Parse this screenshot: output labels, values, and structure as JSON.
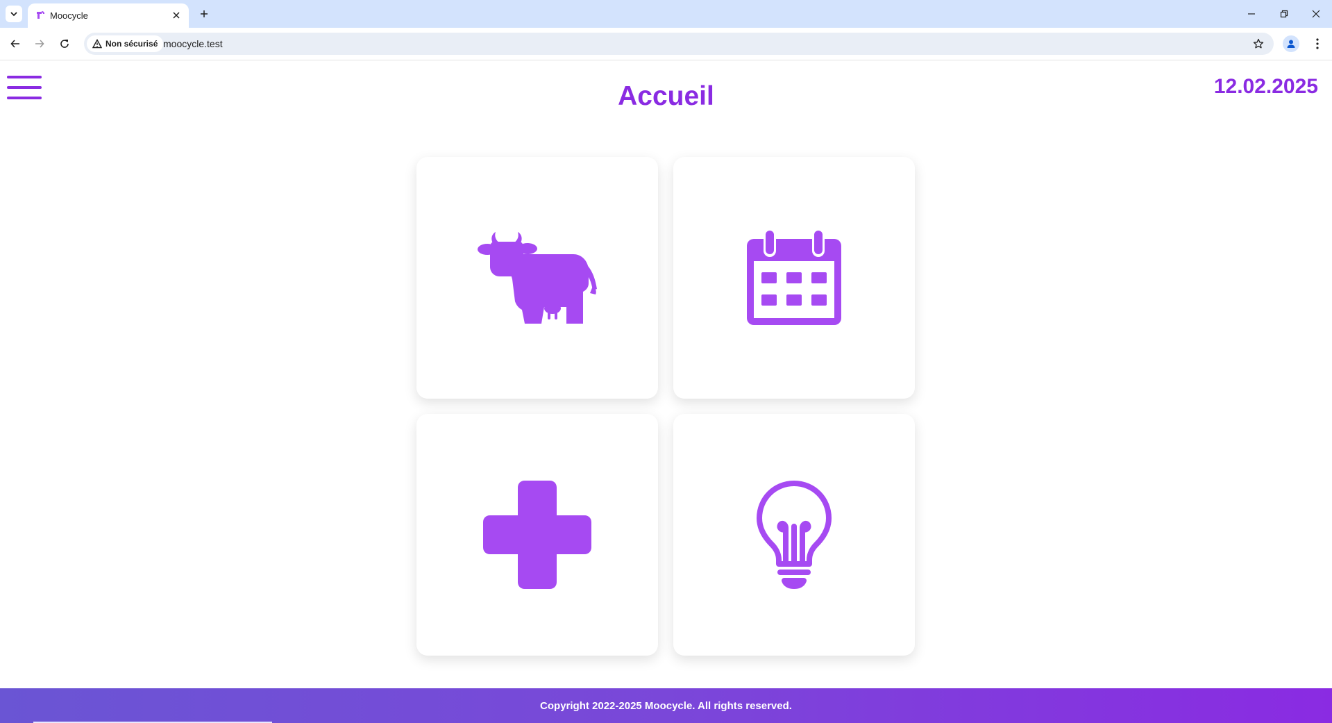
{
  "browser": {
    "tab_title": "Moocycle",
    "security_label": "Non sécurisé",
    "url": "moocycle.test"
  },
  "header": {
    "title": "Accueil",
    "date": "12.02.2025"
  },
  "cards": [
    {
      "icon": "cow-icon"
    },
    {
      "icon": "calendar-icon"
    },
    {
      "icon": "medical-cross-icon"
    },
    {
      "icon": "lightbulb-icon"
    }
  ],
  "colors": {
    "accent": "#8a2be2",
    "icon": "#a64af2",
    "tabbar": "#d3e3fd",
    "footer_start": "#6a55d4",
    "footer_end": "#8a2be2"
  },
  "footer": {
    "copyright": "Copyright 2022-2025 Moocycle. All rights reserved."
  }
}
